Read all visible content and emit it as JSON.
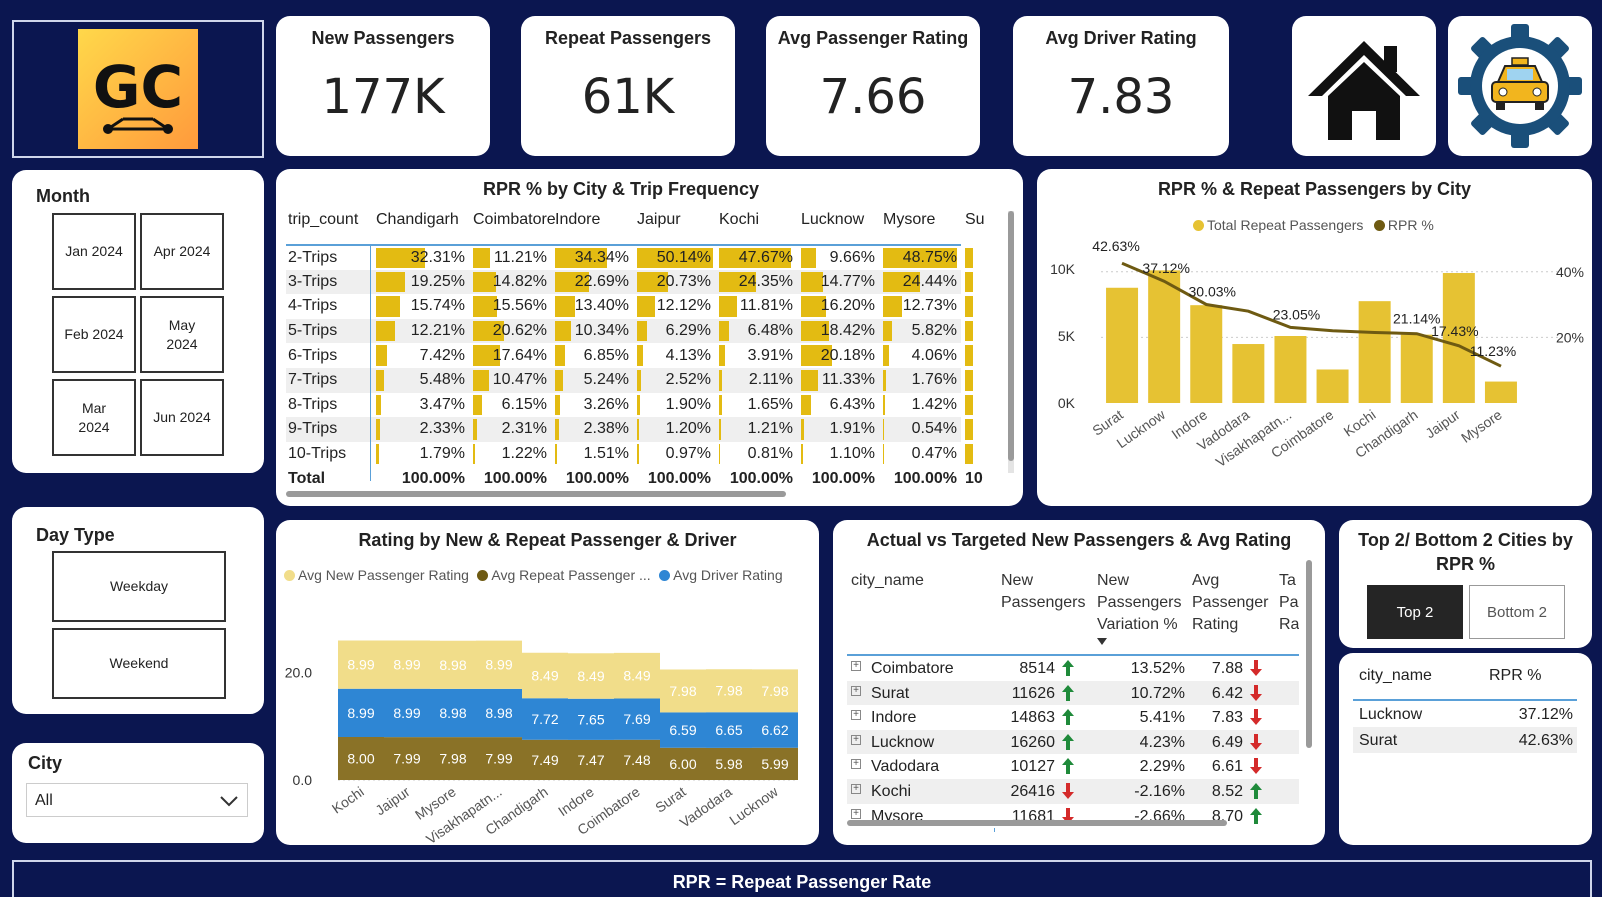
{
  "logo": {
    "text": "GC",
    "bg_from": "#ffd84a",
    "bg_to": "#ff9a3c"
  },
  "kpis": [
    {
      "title": "New Passengers",
      "value": "177K"
    },
    {
      "title": "Repeat Passengers",
      "value": "61K"
    },
    {
      "title": "Avg Passenger Rating",
      "value": "7.66"
    },
    {
      "title": "Avg Driver Rating",
      "value": "7.83"
    }
  ],
  "nav_icons": [
    "home-icon",
    "taxi-gear-icon"
  ],
  "month_slicer": {
    "title": "Month",
    "options": [
      "Jan 2024",
      "Apr 2024",
      "Feb 2024",
      "May 2024",
      "Mar 2024",
      "Jun 2024"
    ]
  },
  "daytype_slicer": {
    "title": "Day Type",
    "options": [
      "Weekday",
      "Weekend"
    ]
  },
  "city_slicer": {
    "title": "City",
    "value": "All"
  },
  "footer": "RPR = Repeat Passenger Rate",
  "colors": {
    "navy": "#0b1650",
    "gold": "#e6c233",
    "olive": "#6e5a12",
    "blue": "#2e86d4",
    "light_gold": "#f1dd8a"
  },
  "rpr_matrix": {
    "title": "RPR % by City & Trip Frequency",
    "row_header": "trip_count",
    "columns": [
      "Chandigarh",
      "Coimbatore",
      "Indore",
      "Jaipur",
      "Kochi",
      "Lucknow",
      "Mysore",
      "Su"
    ],
    "rows": [
      {
        "label": "2-Trips",
        "values": [
          "32.31%",
          "11.21%",
          "34.34%",
          "50.14%",
          "47.67%",
          "9.66%",
          "48.75%"
        ]
      },
      {
        "label": "3-Trips",
        "values": [
          "19.25%",
          "14.82%",
          "22.69%",
          "20.73%",
          "24.35%",
          "14.77%",
          "24.44%"
        ]
      },
      {
        "label": "4-Trips",
        "values": [
          "15.74%",
          "15.56%",
          "13.40%",
          "12.12%",
          "11.81%",
          "16.20%",
          "12.73%"
        ]
      },
      {
        "label": "5-Trips",
        "values": [
          "12.21%",
          "20.62%",
          "10.34%",
          "6.29%",
          "6.48%",
          "18.42%",
          "5.82%"
        ]
      },
      {
        "label": "6-Trips",
        "values": [
          "7.42%",
          "17.64%",
          "6.85%",
          "4.13%",
          "3.91%",
          "20.18%",
          "4.06%"
        ]
      },
      {
        "label": "7-Trips",
        "values": [
          "5.48%",
          "10.47%",
          "5.24%",
          "2.52%",
          "2.11%",
          "11.33%",
          "1.76%"
        ]
      },
      {
        "label": "8-Trips",
        "values": [
          "3.47%",
          "6.15%",
          "3.26%",
          "1.90%",
          "1.65%",
          "6.43%",
          "1.42%"
        ]
      },
      {
        "label": "9-Trips",
        "values": [
          "2.33%",
          "2.31%",
          "2.38%",
          "1.20%",
          "1.21%",
          "1.91%",
          "0.54%"
        ]
      },
      {
        "label": "10-Trips",
        "values": [
          "1.79%",
          "1.22%",
          "1.51%",
          "0.97%",
          "0.81%",
          "1.10%",
          "0.47%"
        ]
      }
    ],
    "total_label": "Total",
    "totals": [
      "100.00%",
      "100.00%",
      "100.00%",
      "100.00%",
      "100.00%",
      "100.00%",
      "100.00%",
      "10"
    ]
  },
  "chart_data": [
    {
      "type": "bar",
      "title": "RPR % & Repeat Passengers by City",
      "categories": [
        "Surat",
        "Lucknow",
        "Indore",
        "Vadodara",
        "Visakhapatn...",
        "Coimbatore",
        "Kochi",
        "Chandigarh",
        "Jaipur",
        "Mysore"
      ],
      "series": [
        {
          "name": "Total Repeat Passengers",
          "values": [
            8600,
            9900,
            7300,
            4400,
            5000,
            2500,
            7600,
            5100,
            9700,
            1600
          ]
        },
        {
          "name": "RPR %",
          "values": [
            42.63,
            37.12,
            30.03,
            28.0,
            23.05,
            22.0,
            21.5,
            21.14,
            17.43,
            11.23
          ]
        }
      ],
      "data_labels": [
        "42.63%",
        "37.12%",
        "30.03%",
        "23.05%",
        "21.14%",
        "17.43%",
        "11.23%"
      ],
      "y_ticks": [
        "10K",
        "5K",
        "0K"
      ],
      "y2_ticks": [
        "40%",
        "20%"
      ],
      "ylim": [
        0,
        10000
      ],
      "y2lim": [
        0,
        50
      ]
    },
    {
      "type": "area",
      "title": "Rating by New & Repeat Passenger & Driver",
      "legend": [
        "Avg New Passenger Rating",
        "Avg Repeat Passenger ...",
        "Avg Driver Rating"
      ],
      "categories": [
        "Kochi",
        "Jaipur",
        "Mysore",
        "Visakhapatn...",
        "Chandigarh",
        "Indore",
        "Coimbatore",
        "Surat",
        "Vadodara",
        "Lucknow"
      ],
      "series": [
        {
          "name": "Avg Repeat Passenger Rating",
          "values": [
            8.0,
            7.99,
            7.98,
            7.99,
            7.49,
            7.47,
            7.48,
            6.0,
            5.98,
            5.99
          ]
        },
        {
          "name": "Avg Driver Rating",
          "values": [
            8.99,
            8.99,
            8.98,
            8.98,
            7.72,
            7.65,
            7.69,
            6.59,
            6.65,
            6.62
          ]
        },
        {
          "name": "Avg New Passenger Rating",
          "values": [
            8.99,
            8.99,
            8.98,
            8.99,
            8.49,
            8.49,
            8.49,
            7.98,
            7.98,
            7.98
          ]
        }
      ],
      "bottom_labels": [
        "8.00",
        "7.99",
        "7.98",
        "7.99",
        "7.49",
        "7.47",
        "7.48",
        "6.00",
        "5.98",
        "5.99"
      ],
      "mid_labels": [
        "8.99",
        "8.99",
        "8.98",
        "8.98",
        "7.72",
        "7.65",
        "7.69",
        "6.59",
        "6.65",
        "6.62"
      ],
      "top_labels": [
        "8.99",
        "8.99",
        "8.98",
        "8.99",
        "8.49",
        "8.49",
        "8.49",
        "7.98",
        "7.98",
        "7.98"
      ],
      "y_ticks": [
        "20.0",
        "0.0"
      ],
      "ylim": [
        0,
        27
      ]
    }
  ],
  "target_table": {
    "title": "Actual vs Targeted New Passengers & Avg Rating",
    "headers": [
      "city_name",
      "New Passengers",
      "New Passengers Variation %",
      "Avg Passenger Rating",
      "Ta Pa Ra"
    ],
    "rows": [
      {
        "city": "Coimbatore",
        "new": "8514",
        "new_dir": "up",
        "var": "13.52%",
        "rating": "7.88",
        "rating_dir": "down"
      },
      {
        "city": "Surat",
        "new": "11626",
        "new_dir": "up",
        "var": "10.72%",
        "rating": "6.42",
        "rating_dir": "down"
      },
      {
        "city": "Indore",
        "new": "14863",
        "new_dir": "up",
        "var": "5.41%",
        "rating": "7.83",
        "rating_dir": "down"
      },
      {
        "city": "Lucknow",
        "new": "16260",
        "new_dir": "up",
        "var": "4.23%",
        "rating": "6.49",
        "rating_dir": "down"
      },
      {
        "city": "Vadodara",
        "new": "10127",
        "new_dir": "up",
        "var": "2.29%",
        "rating": "6.61",
        "rating_dir": "down"
      },
      {
        "city": "Kochi",
        "new": "26416",
        "new_dir": "down",
        "var": "-2.16%",
        "rating": "8.52",
        "rating_dir": "up"
      },
      {
        "city": "Mysore",
        "new": "11681",
        "new_dir": "down",
        "var": "-2.66%",
        "rating": "8.70",
        "rating_dir": "up"
      }
    ]
  },
  "top_bottom": {
    "title": "Top 2/ Bottom 2 Cities by RPR %",
    "buttons": [
      "Top 2",
      "Bottom 2"
    ],
    "headers": [
      "city_name",
      "RPR %"
    ],
    "rows": [
      [
        "Lucknow",
        "37.12%"
      ],
      [
        "Surat",
        "42.63%"
      ]
    ]
  }
}
